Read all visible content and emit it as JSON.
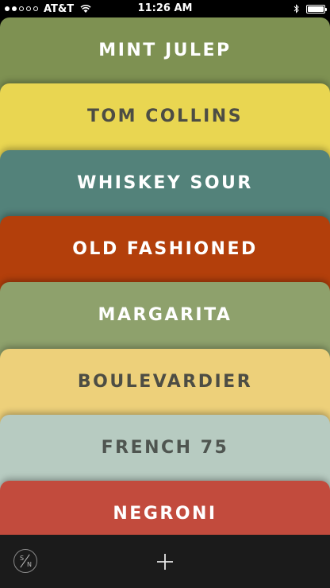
{
  "status_bar": {
    "carrier": "AT&T",
    "time": "11:26 AM",
    "signal_bars_filled": 2,
    "signal_bars_total": 5,
    "battery_level": 1.0,
    "icons": [
      "wifi-icon",
      "bluetooth-icon",
      "battery-icon"
    ]
  },
  "cocktails": [
    {
      "name": "MINT JULEP",
      "color": "#7E9152",
      "text_color": "#FFFFFF"
    },
    {
      "name": "TOM COLLINS",
      "color": "#E9D651",
      "text_color": "#4D4D44"
    },
    {
      "name": "WHISKEY SOUR",
      "color": "#53827A",
      "text_color": "#FFFFFF"
    },
    {
      "name": "OLD FASHIONED",
      "color": "#B33F0B",
      "text_color": "#FFFFFF"
    },
    {
      "name": "MARGARITA",
      "color": "#8EA16C",
      "text_color": "#FFFFFF"
    },
    {
      "name": "BOULEVARDIER",
      "color": "#EDD07A",
      "text_color": "#4D4D44"
    },
    {
      "name": "FRENCH 75",
      "color": "#B7CBC1",
      "text_color": "#4F5550"
    },
    {
      "name": "NEGRONI",
      "color": "#C24B3D",
      "text_color": "#FFFFFF"
    }
  ],
  "toolbar": {
    "logo_top": "S",
    "logo_bottom": "N",
    "icons": [
      "sn-logo-icon",
      "plus-icon"
    ]
  }
}
